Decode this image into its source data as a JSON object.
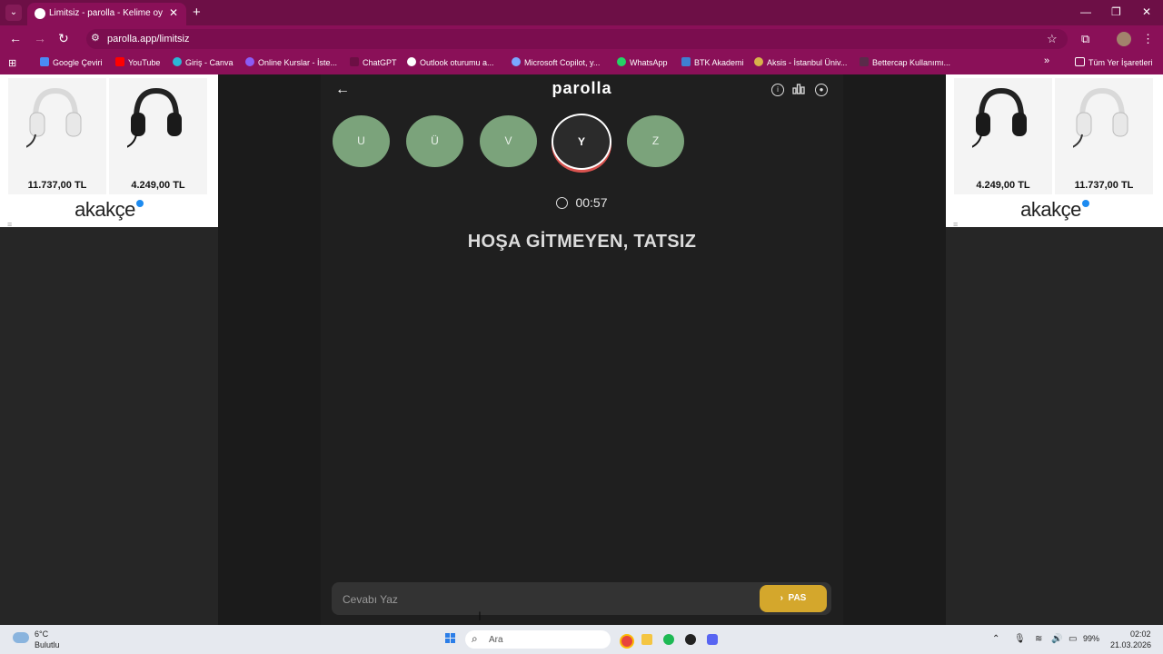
{
  "browser": {
    "tab_title": "Limitsiz - parolla - Kelime oyunu",
    "url": "parolla.app/limitsiz",
    "bookmarks": [
      "Google Çeviri",
      "YouTube",
      "Giriş - Canva",
      "Online Kurslar - İste...",
      "ChatGPT",
      "Outlook oturumu a...",
      "Microsoft Copilot, y...",
      "WhatsApp",
      "BTK Akademi",
      "Aksis - İstanbul Üniv...",
      "Bettercap Kullanımı..."
    ],
    "all_bookmarks": "Tüm Yer İşaretleri"
  },
  "ads": {
    "left_prices": [
      "11.737,00 TL",
      "4.249,00 TL"
    ],
    "right_prices": [
      "4.249,00 TL",
      "11.737,00 TL"
    ],
    "brand": "akakçe"
  },
  "game": {
    "logo": "parolla",
    "letters": [
      "U",
      "Ü",
      "V",
      "Y",
      "Z"
    ],
    "active_letter": "Y",
    "timer": "00:57",
    "question": "HOŞA GİTMEYEN, TATSIZ",
    "answer_placeholder": "Cevabı Yaz",
    "pass_label": "PAS"
  },
  "taskbar": {
    "weather_temp": "6°C",
    "weather_desc": "Bulutlu",
    "search_placeholder": "Ara",
    "battery": "99%",
    "time": "02:02",
    "date": "21.03.2026"
  },
  "colors": {
    "chrome": "#8a1058",
    "letter_bg": "#7ba37b",
    "active_ring": "#d9534f",
    "pass_btn": "#d4a72c"
  }
}
